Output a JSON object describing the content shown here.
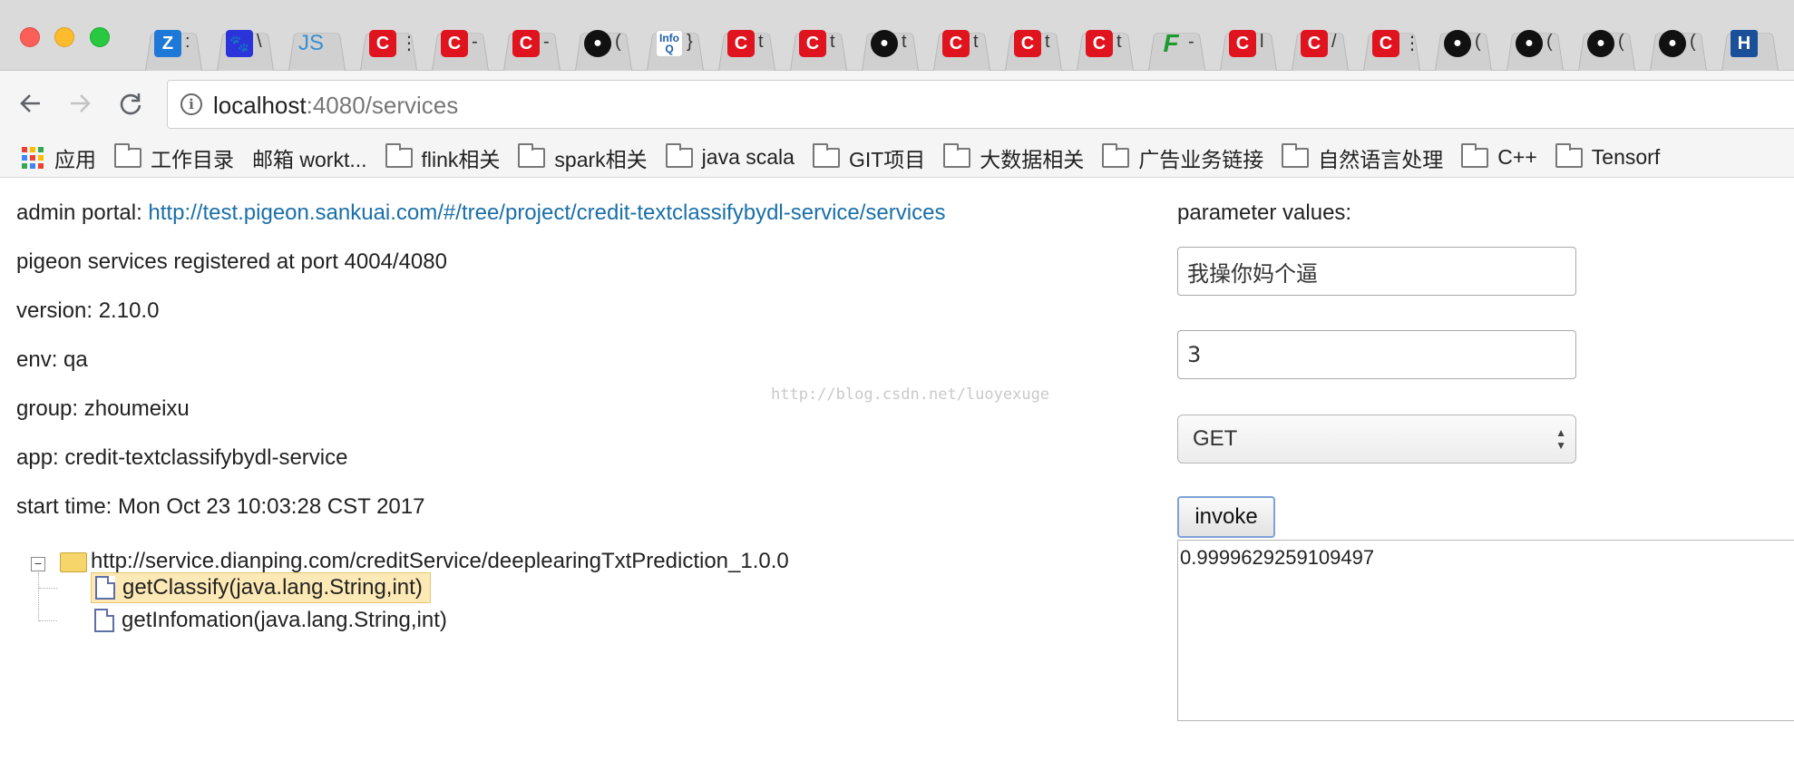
{
  "browser": {
    "tabs": [
      {
        "icon": "zhihu-icon",
        "glyph": "Z",
        "cls": "zhi",
        "title": ":"
      },
      {
        "icon": "baidu-paw-icon",
        "glyph": "🐾",
        "cls": "paw",
        "title": "\\"
      },
      {
        "icon": "js-icon",
        "glyph": "JS",
        "cls": "js",
        "title": ""
      },
      {
        "icon": "csdn-icon",
        "glyph": "C",
        "cls": "c",
        "title": "⋮"
      },
      {
        "icon": "csdn-icon",
        "glyph": "C",
        "cls": "c",
        "title": "-"
      },
      {
        "icon": "csdn-icon",
        "glyph": "C",
        "cls": "c",
        "title": "-"
      },
      {
        "icon": "github-icon",
        "glyph": "●",
        "cls": "gh",
        "title": "("
      },
      {
        "icon": "infoq-icon",
        "glyph": "Info Q",
        "cls": "info",
        "title": "}"
      },
      {
        "icon": "csdn-icon",
        "glyph": "C",
        "cls": "c",
        "title": "t"
      },
      {
        "icon": "csdn-icon",
        "glyph": "C",
        "cls": "c",
        "title": "t"
      },
      {
        "icon": "github-icon",
        "glyph": "●",
        "cls": "gh",
        "title": "t"
      },
      {
        "icon": "csdn-icon",
        "glyph": "C",
        "cls": "c",
        "title": "t"
      },
      {
        "icon": "csdn-icon",
        "glyph": "C",
        "cls": "c",
        "title": "t"
      },
      {
        "icon": "csdn-icon",
        "glyph": "C",
        "cls": "c",
        "title": "t"
      },
      {
        "icon": "scala-f-icon",
        "glyph": "F",
        "cls": "f",
        "title": "-"
      },
      {
        "icon": "csdn-icon",
        "glyph": "C",
        "cls": "c",
        "title": "l"
      },
      {
        "icon": "csdn-icon",
        "glyph": "C",
        "cls": "c",
        "title": "/"
      },
      {
        "icon": "csdn-icon",
        "glyph": "C",
        "cls": "c",
        "title": "⋮"
      },
      {
        "icon": "github-icon",
        "glyph": "●",
        "cls": "gh",
        "title": "("
      },
      {
        "icon": "github-icon",
        "glyph": "●",
        "cls": "gh",
        "title": "("
      },
      {
        "icon": "github-icon",
        "glyph": "●",
        "cls": "gh",
        "title": "("
      },
      {
        "icon": "github-icon",
        "glyph": "●",
        "cls": "gh",
        "title": "("
      },
      {
        "icon": "h-icon",
        "glyph": "H",
        "cls": "h",
        "title": ""
      }
    ],
    "url_host": "localhost",
    "url_path": ":4080/services",
    "bookmarks": [
      {
        "label": "应用",
        "icon": "apps-grid-icon"
      },
      {
        "label": "工作目录",
        "icon": "folder-icon"
      },
      {
        "label": "邮箱 workt...",
        "icon": ""
      },
      {
        "label": "flink相关",
        "icon": "folder-icon"
      },
      {
        "label": "spark相关",
        "icon": "folder-icon"
      },
      {
        "label": "java scala",
        "icon": "folder-icon"
      },
      {
        "label": "GIT项目",
        "icon": "folder-icon"
      },
      {
        "label": "大数据相关",
        "icon": "folder-icon"
      },
      {
        "label": "广告业务链接",
        "icon": "folder-icon"
      },
      {
        "label": "自然语言处理",
        "icon": "folder-icon"
      },
      {
        "label": "C++",
        "icon": "folder-icon"
      },
      {
        "label": "Tensorf",
        "icon": "folder-icon"
      }
    ]
  },
  "info": {
    "admin_label": "admin portal: ",
    "admin_link": "http://test.pigeon.sankuai.com/#/tree/project/credit-textclassifybydl-service/services",
    "registered": "pigeon services registered at port 4004/4080",
    "version": "version: 2.10.0",
    "env": "env: qa",
    "group": "group: zhoumeixu",
    "app": "app: credit-textclassifybydl-service",
    "start_time": "start time: Mon Oct 23 10:03:28 CST 2017"
  },
  "watermark": "http://blog.csdn.net/luoyexuge",
  "tree": {
    "root": "http://service.dianping.com/creditService/deeplearingTxtPrediction_1.0.0",
    "methods": [
      {
        "label": "getClassify(java.lang.String,int)",
        "selected": true
      },
      {
        "label": "getInfomation(java.lang.String,int)",
        "selected": false
      }
    ]
  },
  "panel": {
    "param_label": "parameter values:",
    "param1": "我操你妈个逼",
    "param2": "3",
    "method": "GET",
    "invoke": "invoke",
    "result": "0.9999629259109497"
  },
  "colors": {
    "link": "#1a6fa8",
    "selected_bg": "#fde9b5",
    "csdn_red": "#e0141e"
  }
}
